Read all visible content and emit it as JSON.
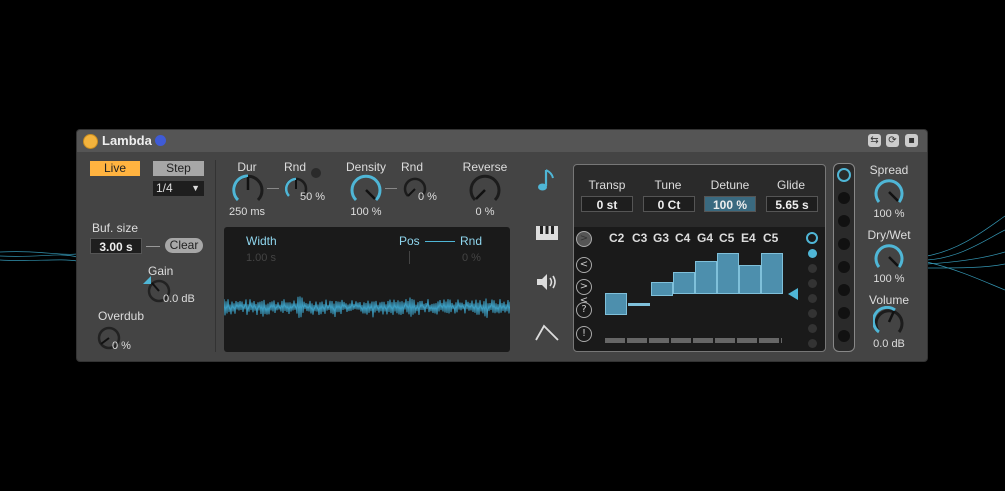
{
  "device": {
    "title": "Lambda",
    "mode_live": "Live",
    "mode_step": "Step",
    "step_division": "1/4",
    "buf_size_label": "Buf. size",
    "buf_size_value": "3.00 s",
    "clear_label": "Clear",
    "gain_label": "Gain",
    "gain_value": "0.0 dB",
    "overdub_label": "Overdub",
    "overdub_value": "0 %"
  },
  "grain": {
    "dur_label": "Dur",
    "dur_value": "250 ms",
    "dur_rnd_label": "Rnd",
    "dur_rnd_value": "50 %",
    "density_label": "Density",
    "density_value": "100 %",
    "density_rnd_label": "Rnd",
    "density_rnd_value": "0 %",
    "reverse_label": "Reverse",
    "reverse_value": "0 %"
  },
  "wave": {
    "width_label": "Width",
    "width_value": "1.00 s",
    "pos_label": "Pos",
    "pos_rnd_label": "Rnd",
    "pos_rnd_value": "0 %"
  },
  "pitch": {
    "transp_label": "Transp",
    "transp_value": "0 st",
    "tune_label": "Tune",
    "tune_value": "0 Ct",
    "detune_label": "Detune",
    "detune_value": "100 %",
    "glide_label": "Glide",
    "glide_value": "5.65 s",
    "notes": [
      "C2",
      "C3",
      "G3",
      "C4",
      "G4",
      "C5",
      "E4",
      "C5"
    ],
    "seq_buttons": [
      ">",
      "<",
      "><",
      "?",
      "!"
    ]
  },
  "output": {
    "spread_label": "Spread",
    "spread_value": "100 %",
    "drywet_label": "Dry/Wet",
    "drywet_value": "100 %",
    "volume_label": "Volume",
    "volume_value": "0.0 dB"
  },
  "icons": {
    "note": "music-note-icon",
    "keyboard": "piano-keys-icon",
    "speaker": "speaker-icon",
    "envelope": "envelope-curve-icon"
  },
  "colors": {
    "accent": "#4fb6d6",
    "live": "#ffb340",
    "panel": "#444444"
  }
}
